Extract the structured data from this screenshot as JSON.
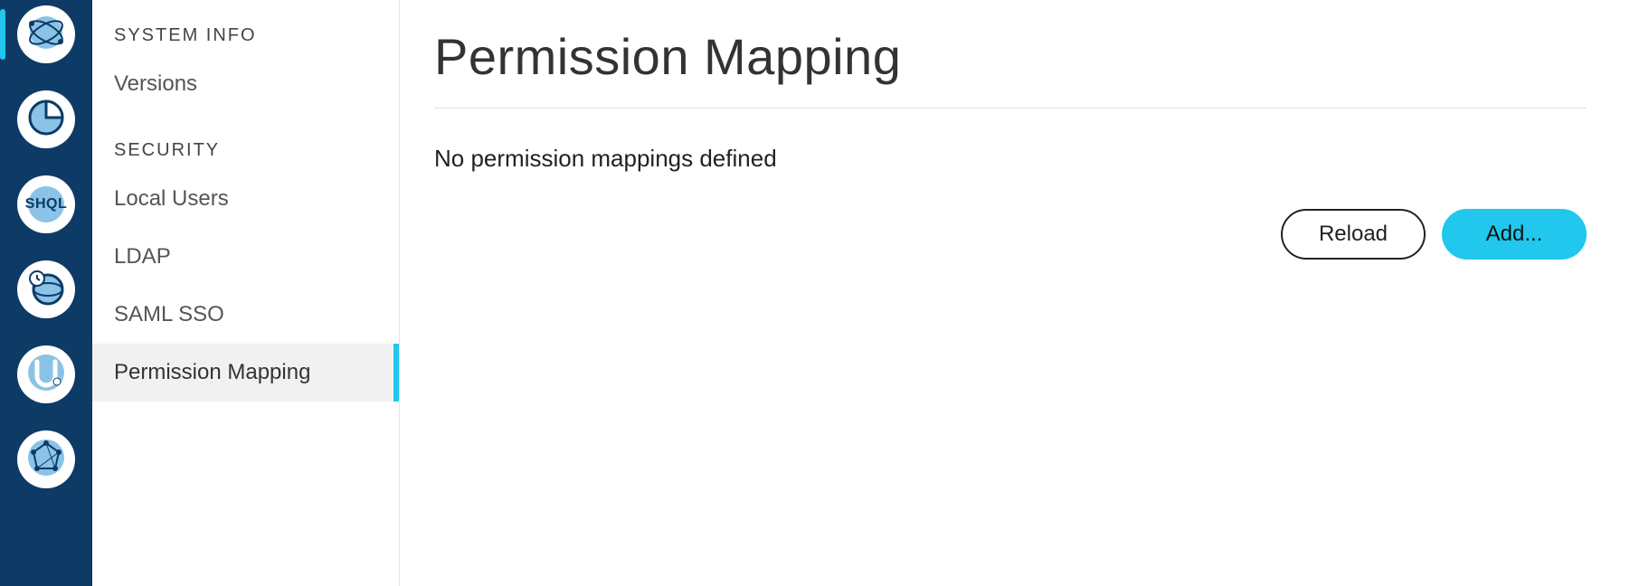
{
  "rail": {
    "icons": [
      {
        "name": "globe-atom-icon"
      },
      {
        "name": "pie-chart-icon"
      },
      {
        "name": "shql-icon",
        "text": "SHQL"
      },
      {
        "name": "globe-clock-icon"
      },
      {
        "name": "u-path-icon"
      },
      {
        "name": "network-topology-icon"
      }
    ],
    "active_index": 0
  },
  "sidenav": {
    "sections": [
      {
        "header": "SYSTEM INFO",
        "items": [
          {
            "label": "Versions",
            "active": false
          }
        ]
      },
      {
        "header": "SECURITY",
        "items": [
          {
            "label": "Local Users",
            "active": false
          },
          {
            "label": "LDAP",
            "active": false
          },
          {
            "label": "SAML SSO",
            "active": false
          },
          {
            "label": "Permission Mapping",
            "active": true
          }
        ]
      }
    ]
  },
  "main": {
    "title": "Permission Mapping",
    "empty_message": "No permission mappings defined",
    "buttons": {
      "reload": "Reload",
      "add": "Add..."
    }
  }
}
